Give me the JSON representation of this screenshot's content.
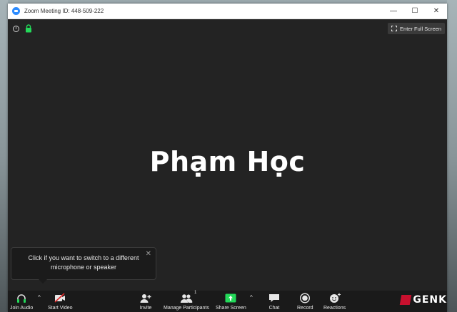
{
  "window": {
    "title": "Zoom Meeting ID: 448-509-222",
    "minimize_glyph": "—",
    "maximize_glyph": "☐",
    "close_glyph": "✕"
  },
  "stage": {
    "info_glyph": "i",
    "fullscreen_label": "Enter Full Screen",
    "participant_name": "Phạm Học"
  },
  "tooltip": {
    "text_line1": "Click if you want to switch to a different",
    "text_line2": "microphone or speaker",
    "close_glyph": "✕"
  },
  "toolbar": {
    "join_audio": "Join Audio",
    "start_video": "Start Video",
    "invite": "Invite",
    "manage_participants": "Manage Participants",
    "participant_count": "1",
    "share_screen": "Share Screen",
    "chat": "Chat",
    "record": "Record",
    "reactions": "Reactions",
    "caret_glyph": "^"
  },
  "watermark": {
    "text": "GENK"
  },
  "colors": {
    "accent_blue": "#2d8cff",
    "lock_green": "#23d959",
    "share_green": "#23d959",
    "video_off_red": "#e02828",
    "stage_bg": "#232323",
    "toolbar_bg": "#1a1a1a"
  },
  "icons": {
    "app": "zoom-camera-icon",
    "info": "info-icon",
    "lock": "lock-icon",
    "fullscreen": "expand-icon",
    "headphone": "headphone-icon",
    "video": "video-off-icon",
    "invite": "add-person-icon",
    "participants": "people-icon",
    "share": "share-up-arrow-icon",
    "chat": "chat-bubble-icon",
    "record": "record-circle-icon",
    "reactions": "smiley-plus-icon"
  }
}
